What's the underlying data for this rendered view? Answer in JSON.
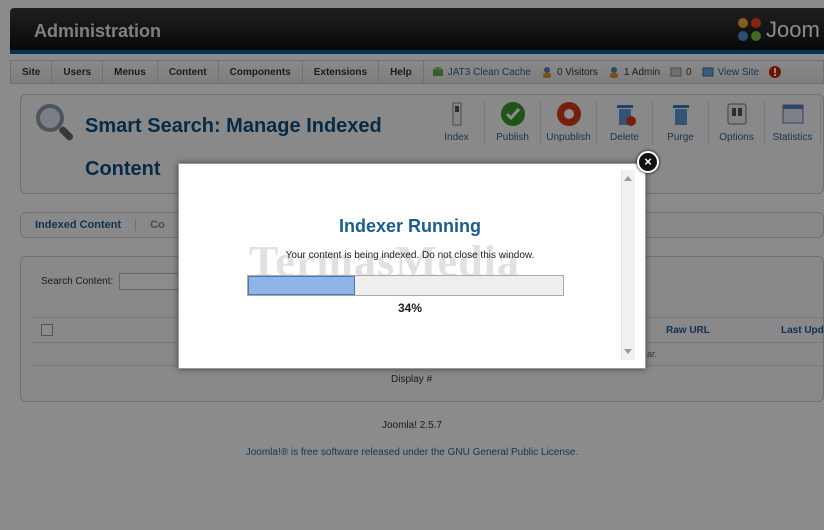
{
  "header": {
    "title": "Administration",
    "logo_text": "Joom"
  },
  "menu": {
    "items": [
      "Site",
      "Users",
      "Menus",
      "Content",
      "Components",
      "Extensions",
      "Help"
    ],
    "status": [
      {
        "label": "JAT3 Clean Cache",
        "icon": "cache-icon"
      },
      {
        "label": "0 Visitors",
        "icon": "visitors-icon"
      },
      {
        "label": "1 Admin",
        "icon": "admin-icon"
      },
      {
        "label": "0",
        "icon": "messages-icon"
      },
      {
        "label": "View Site",
        "icon": "view-site-icon"
      }
    ]
  },
  "page": {
    "title": "Smart Search: Manage Indexed Content"
  },
  "toolbar": {
    "index": "Index",
    "publish": "Publish",
    "unpublish": "Unpublish",
    "delete": "Delete",
    "purge": "Purge",
    "options": "Options",
    "statistics": "Statistics"
  },
  "tabs": {
    "indexed_content": "Indexed Content",
    "other_partial": "Co"
  },
  "filter": {
    "search_label": "Search Content:",
    "search_value": ""
  },
  "table": {
    "columns": {
      "raw_url": "Raw URL",
      "last_updated": "Last Upd"
    },
    "hint_partial": "ar.",
    "display_label": "Display #"
  },
  "footer": {
    "version": "Joomla! 2.5.7",
    "license_link": "Joomla!®",
    "license_text": " is free software released under the ",
    "license_link2": "GNU General Public License",
    "license_end": "."
  },
  "modal": {
    "title": "Indexer Running",
    "message": "Your content is being indexed. Do not close this window.",
    "progress_percent": 34,
    "progress_label": "34%",
    "close_glyph": "×",
    "watermark": "TermasMedia"
  }
}
